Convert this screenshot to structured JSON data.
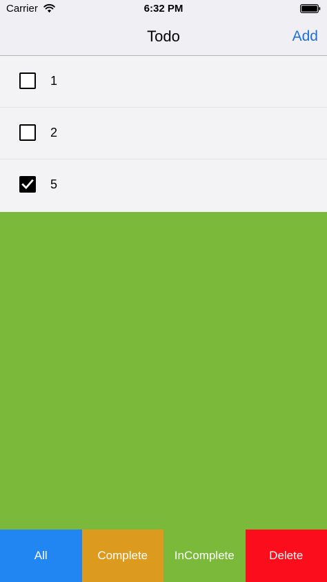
{
  "status_bar": {
    "carrier": "Carrier",
    "time": "6:32 PM",
    "wifi_icon": "wifi-icon",
    "battery_icon": "battery-icon"
  },
  "nav": {
    "title": "Todo",
    "add_label": "Add"
  },
  "todos": [
    {
      "label": "1",
      "checked": false
    },
    {
      "label": "2",
      "checked": false
    },
    {
      "label": "5",
      "checked": true
    }
  ],
  "tabs": [
    {
      "label": "All",
      "color": "#2186f1"
    },
    {
      "label": "Complete",
      "color": "#dc9a1e"
    },
    {
      "label": "InComplete",
      "color": "#7ab93a"
    },
    {
      "label": "Delete",
      "color": "#fc0d1b"
    }
  ],
  "colors": {
    "background": "#7ab93a",
    "accent": "#1e6fd9",
    "list_background": "#f3f3f5"
  }
}
